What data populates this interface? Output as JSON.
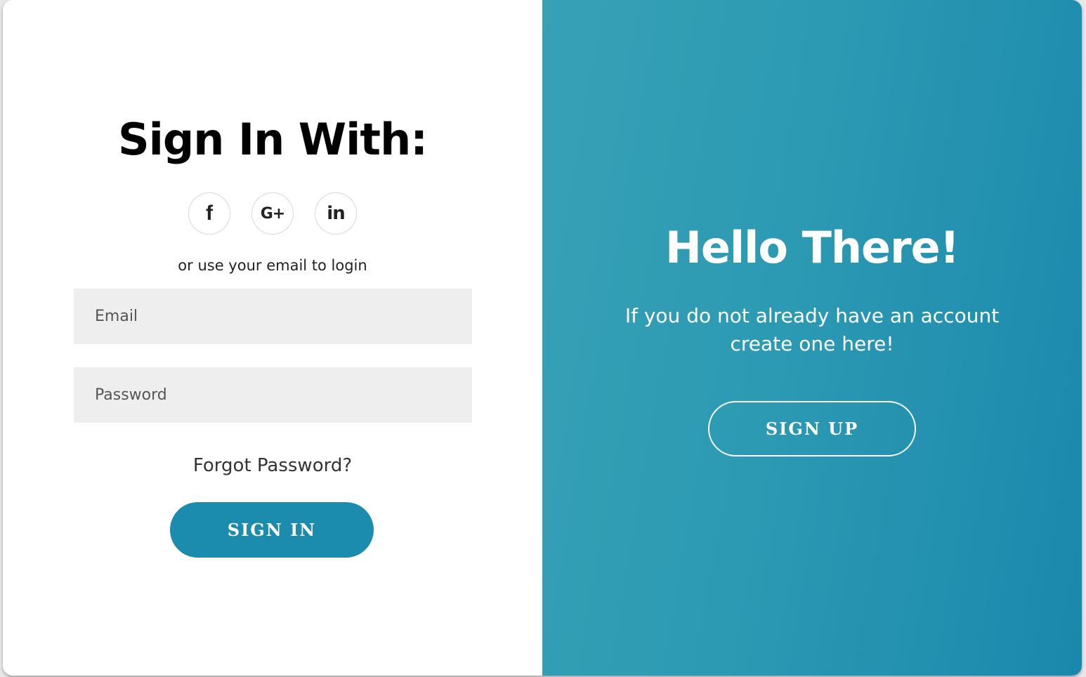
{
  "signin": {
    "title": "Sign In With:",
    "social": [
      {
        "icon": "facebook-icon",
        "glyph": "f"
      },
      {
        "icon": "google-plus-icon",
        "glyph": "G+"
      },
      {
        "icon": "linkedin-icon",
        "glyph": "in"
      }
    ],
    "alt_text": "or use your email to login",
    "email_placeholder": "Email",
    "password_placeholder": "Password",
    "forgot_label": "Forgot Password?",
    "button_label": "SIGN IN"
  },
  "signup": {
    "title": "Hello There!",
    "subtitle": "If you do not already have an account create one here!",
    "button_label": "SIGN UP"
  },
  "colors": {
    "accent": "#1b8cae",
    "panel_gradient_start": "#37a1b6",
    "panel_gradient_end": "#1a88ac",
    "field_bg": "#eeeeee"
  }
}
